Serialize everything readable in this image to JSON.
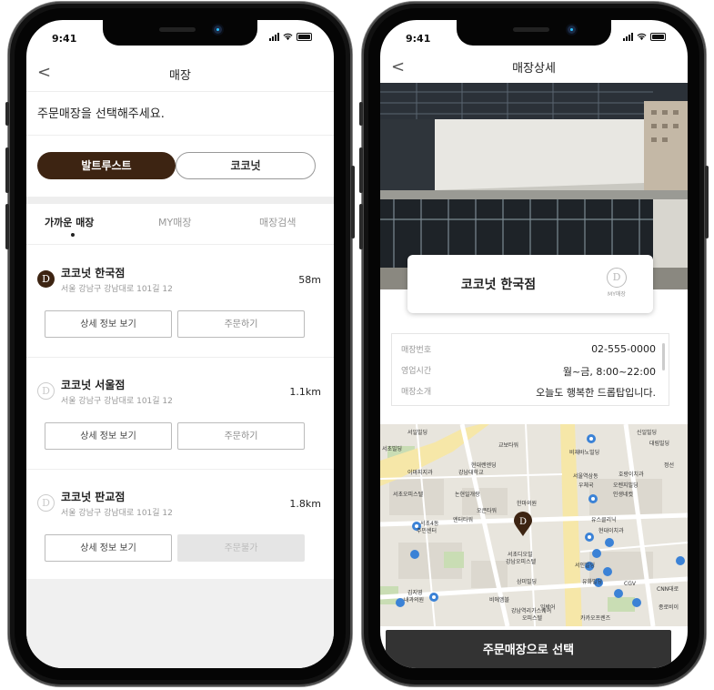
{
  "left": {
    "status_time": "9:41",
    "back": "<",
    "title": "매장",
    "prompt": "주문매장을 선택해주세요.",
    "brand_tabs": {
      "active": "발트루스트",
      "inactive": "코코넛"
    },
    "sub_tabs": {
      "nearby": "가까운 매장",
      "my": "MY매장",
      "search": "매장검색"
    },
    "stores": [
      {
        "icon": "D",
        "name": "코코넛 한국점",
        "address": "서울 강남구 강남대로 101길 12",
        "distance": "58m",
        "detail": "상세 정보 보기",
        "order": "주문하기"
      },
      {
        "icon": "D",
        "name": "코코넛 서울점",
        "address": "서울 강남구 강남대로 101길 12",
        "distance": "1.1km",
        "detail": "상세 정보 보기",
        "order": "주문하기"
      },
      {
        "icon": "D",
        "name": "코코넛 판교점",
        "address": "서울 강남구 강남대로 101길 12",
        "distance": "1.8km",
        "detail": "상세 정보 보기",
        "order": "주문불가"
      }
    ]
  },
  "right": {
    "status_time": "9:41",
    "back": "<",
    "title": "매장상세",
    "store_name": "코코넛 한국점",
    "my_icon": "D",
    "my_label": "MY매장",
    "info": [
      {
        "label": "매장번호",
        "value": "02-555-0000"
      },
      {
        "label": "영업시간",
        "value": "월~금, 8:00~22:00"
      },
      {
        "label": "매장소개",
        "value": "오늘도 행복한 드롭탑입니다."
      }
    ],
    "map_labels": [
      "서일빌딩",
      "서초빌딩",
      "이마지지과",
      "현대렌엔딩",
      "강남대학교",
      "교보타워",
      "비재바노빌딩",
      "서초오피스텔",
      "논현일개랑",
      "오큰타워",
      "한마의원",
      "서울역삼동",
      "우체국",
      "호랑이치과",
      "오렌지빌딩",
      "인생네컷",
      "서초4동",
      "주민센터",
      "엔터타워",
      "서초디오빌",
      "강남오피스텔",
      "유스클리닉",
      "현대이치과",
      "삼미빌딩",
      "서인빌딩",
      "CGV",
      "김지영",
      "내과의원",
      "유화빌딩",
      "비에엠블",
      "익박어",
      "강남역리가스퀘어",
      "오피스텔",
      "카카오프렌즈",
      "CNN대로",
      "종로비이",
      "신일빌딩",
      "대림빌딩",
      "정선"
    ],
    "cta": "주문매장으로 선택",
    "colors": {
      "brand_brown": "#3d2412",
      "cta_dark": "#333333"
    }
  }
}
